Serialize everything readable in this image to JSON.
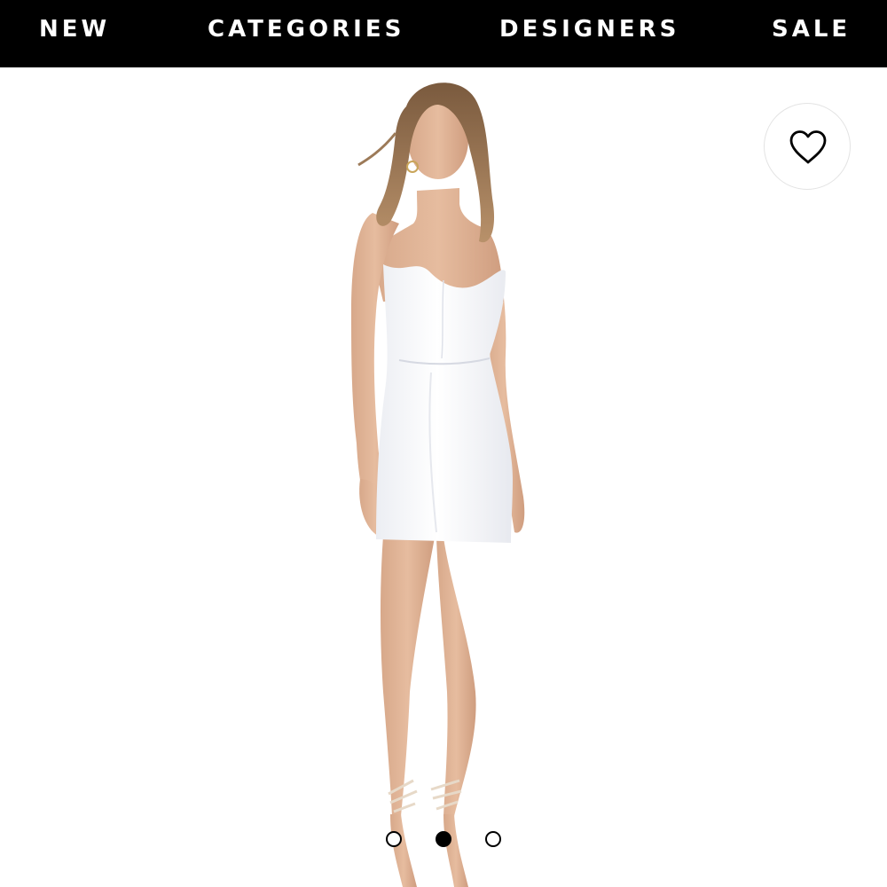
{
  "nav": {
    "items": [
      {
        "label": "NEW"
      },
      {
        "label": "CATEGORIES"
      },
      {
        "label": "DESIGNERS"
      },
      {
        "label": "SALE"
      }
    ],
    "background": "#000000",
    "text_color": "#ffffff"
  },
  "product": {
    "image_icon": "product-photo",
    "dress_color": "#ffffff",
    "wishlist_icon": "heart-outline-icon"
  },
  "carousel": {
    "total": 3,
    "active_index": 2
  }
}
